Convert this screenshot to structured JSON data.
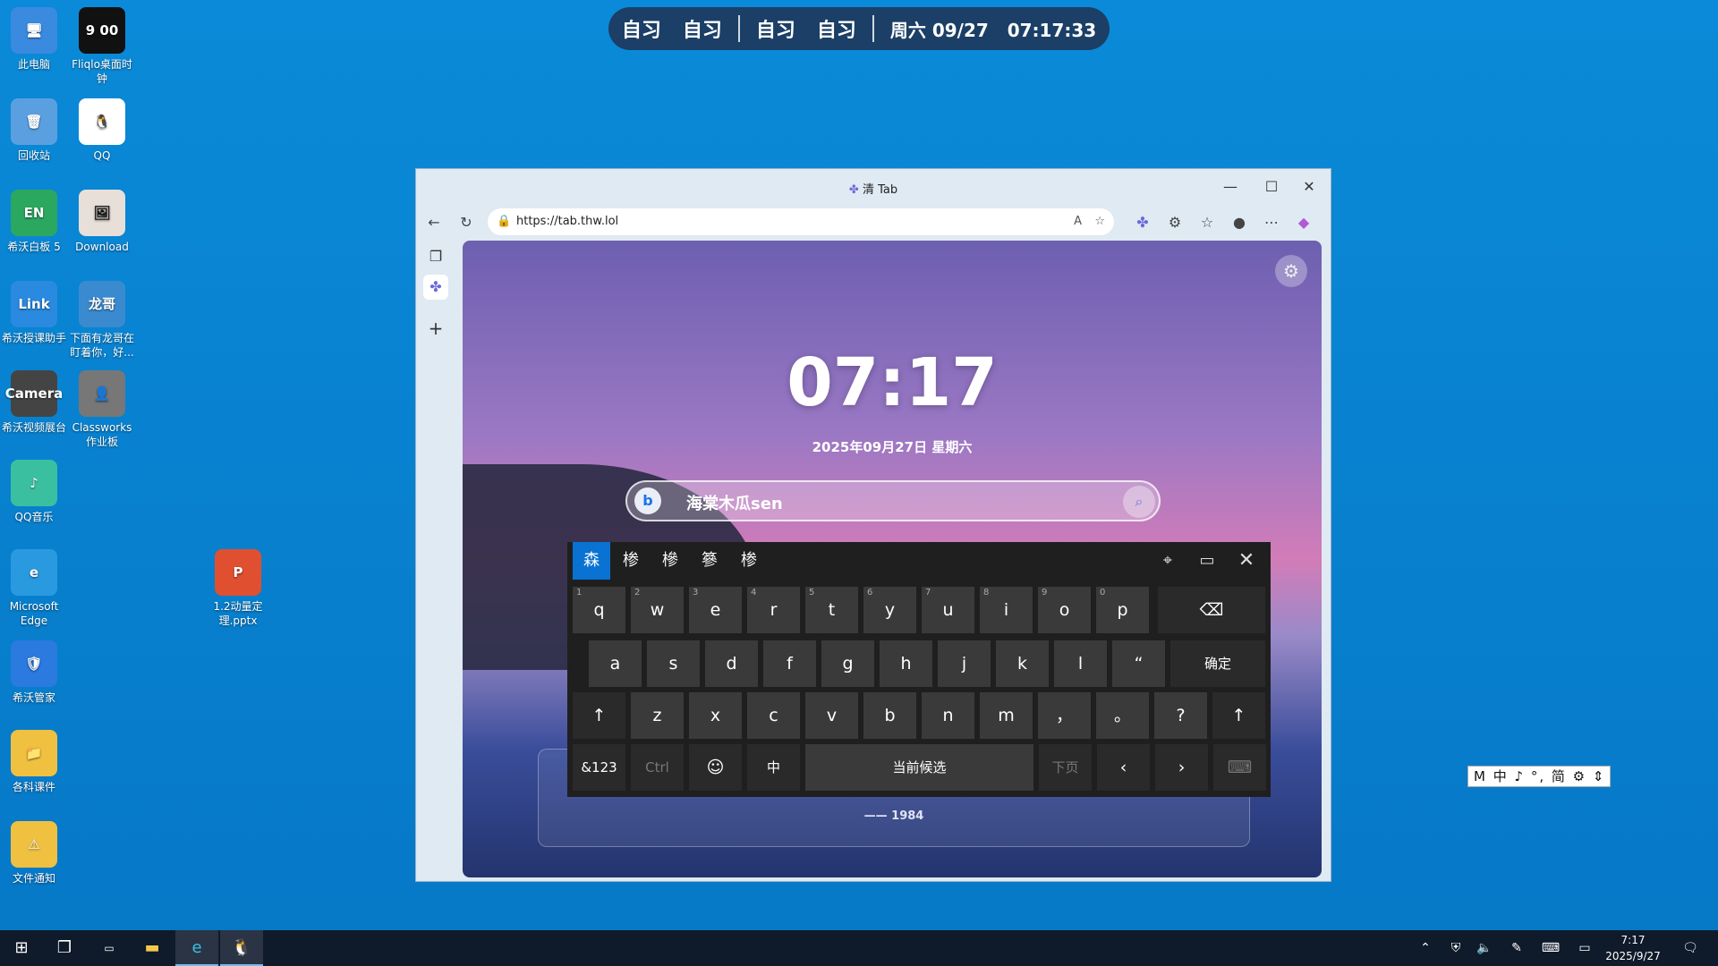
{
  "desktop": {
    "icons": [
      {
        "label": "此电脑",
        "glyph": "🖥"
      },
      {
        "label": "Fliqlo桌面时钟",
        "glyph": "9 00"
      },
      {
        "label": "回收站",
        "glyph": "🗑"
      },
      {
        "label": "QQ",
        "glyph": "🐧"
      },
      {
        "label": "希沃白板 5",
        "glyph": "EN"
      },
      {
        "label": "Download",
        "glyph": "🖼"
      },
      {
        "label": "希沃授课助手",
        "glyph": "Link"
      },
      {
        "label": "下面有龙哥在盯着你，好...",
        "glyph": "龙哥"
      },
      {
        "label": "希沃视频展台",
        "glyph": "Camera"
      },
      {
        "label": "Classworks作业板",
        "glyph": "👤"
      },
      {
        "label": "QQ音乐",
        "glyph": "♪"
      },
      {
        "label": "Microsoft Edge",
        "glyph": "e"
      },
      {
        "label": "希沃管家",
        "glyph": "🛡"
      },
      {
        "label": "各科课件",
        "glyph": "📁"
      },
      {
        "label": "文件通知",
        "glyph": "⚠"
      },
      {
        "label": "1.2动量定理.pptx",
        "glyph": "P"
      }
    ]
  },
  "schedule": {
    "items": [
      "自习",
      "自习",
      "自习",
      "自习"
    ],
    "datetime": "周六 09/27   07:17:33"
  },
  "browser": {
    "title": "清 Tab",
    "url": "https://tab.thw.lol",
    "newtab": {
      "clock": "07:17",
      "date": "2025年09月27日 星期六",
      "search_value": "海棠木瓜sen",
      "quote_source": "—— 1984"
    }
  },
  "keyboard": {
    "candidates": [
      "森",
      "椮",
      "槮",
      "篸",
      "椮"
    ],
    "row1": [
      {
        "k": "q",
        "n": "1"
      },
      {
        "k": "w",
        "n": "2"
      },
      {
        "k": "e",
        "n": "3"
      },
      {
        "k": "r",
        "n": "4"
      },
      {
        "k": "t",
        "n": "5"
      },
      {
        "k": "y",
        "n": "6"
      },
      {
        "k": "u",
        "n": "7"
      },
      {
        "k": "i",
        "n": "8"
      },
      {
        "k": "o",
        "n": "9"
      },
      {
        "k": "p",
        "n": "0"
      }
    ],
    "row2": [
      "a",
      "s",
      "d",
      "f",
      "g",
      "h",
      "j",
      "k",
      "l",
      "“"
    ],
    "confirm": "确定",
    "row3": [
      "z",
      "x",
      "c",
      "v",
      "b",
      "n",
      "m",
      "，",
      "。",
      "?"
    ],
    "sym": "&123",
    "ctrl": "Ctrl",
    "lang": "中",
    "space": "当前候选",
    "next": "下页"
  },
  "ime_bar": "M 中 ♪ °, 简 ⚙ ⇕",
  "taskbar": {
    "time": "7:17",
    "date": "2025/9/27"
  }
}
